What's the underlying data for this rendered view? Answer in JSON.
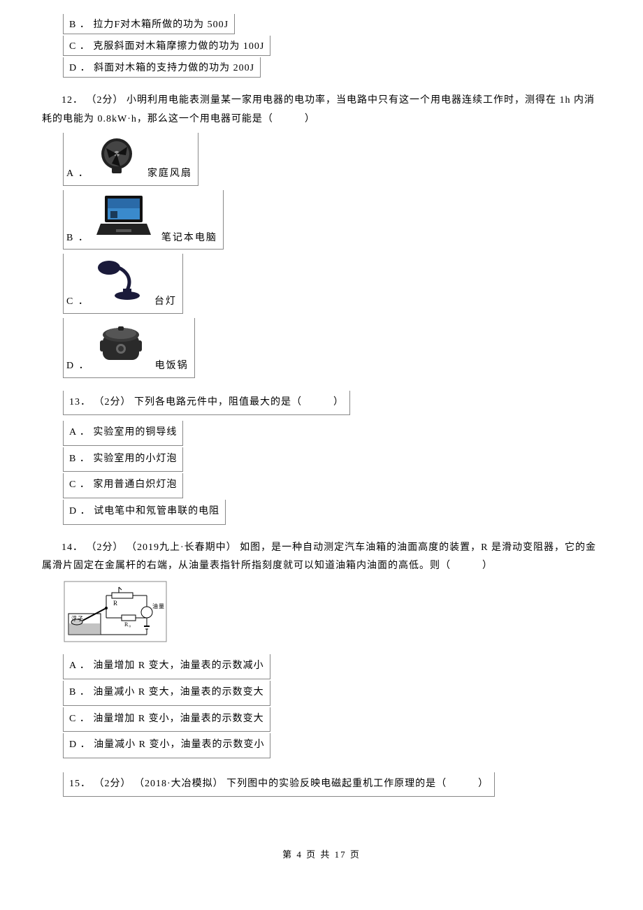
{
  "q11": {
    "optB": "B ． 拉力F对木箱所做的功为 500J",
    "optC": "C ． 克服斜面对木箱摩擦力做的功为 100J",
    "optD": "D ． 斜面对木箱的支持力做的功为 200J"
  },
  "q12": {
    "stem": "12． （2分） 小明利用电能表测量某一家用电器的电功率，当电路中只有这一个用电器连续工作时，测得在 1h 内消耗的电能为 0.8kW·h，那么这一个用电器可能是（　　　）",
    "optA_label": "A ．",
    "optA_caption": "家庭风扇",
    "optB_label": "B ．",
    "optB_caption": "笔记本电脑",
    "optC_label": "C ．",
    "optC_caption": "台灯",
    "optD_label": "D ．",
    "optD_caption": "电饭锅"
  },
  "q13": {
    "stem": "13． （2分） 下列各电路元件中，阻值最大的是（　　　）",
    "optA": "A ． 实验室用的铜导线",
    "optB": "B ． 实验室用的小灯泡",
    "optC": "C ． 家用普通白炽灯泡",
    "optD": "D ． 试电笔中和氖管串联的电阻"
  },
  "q14": {
    "stem": "14． （2分） （2019九上·长春期中） 如图，是一种自动测定汽车油箱的油面高度的装置，R 是滑动变阻器，它的金属滑片固定在金属杆的右端，从油量表指针所指刻度就可以知道油箱内油面的高低。则（　　　）",
    "optA": "A ． 油量增加 R 变大，油量表的示数减小",
    "optB": "B ． 油量减小 R 变大，油量表的示数变大",
    "optC": "C ． 油量增加 R 变小，油量表的示数变大",
    "optD": "D ． 油量减小 R 变小，油量表的示数变小"
  },
  "q15": {
    "stem": "15． （2分） （2018·大冶模拟） 下列图中的实验反映电磁起重机工作原理的是（　　　）"
  },
  "footer": "第 4 页 共 17 页"
}
